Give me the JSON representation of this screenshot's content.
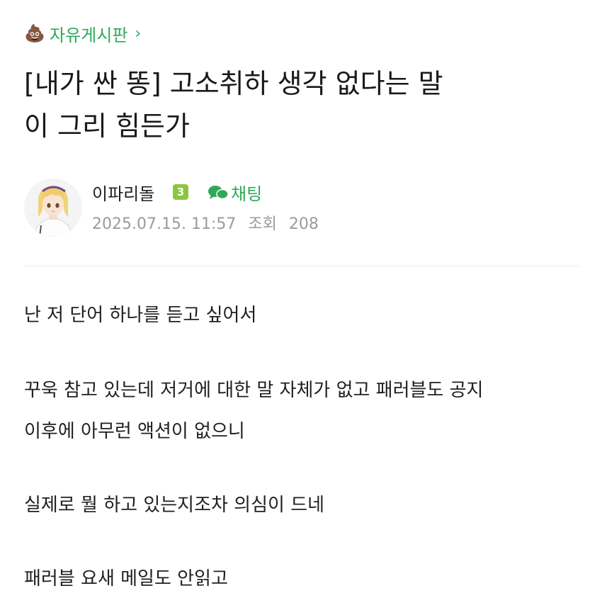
{
  "board": {
    "icon": "poop-emoji-icon",
    "icon_glyph": "💩",
    "name": "자유게시판",
    "chevron": "›"
  },
  "post": {
    "title_line1": "[내가 싼 똥] 고소취하 생각 없다는 말",
    "title_line2": "이 그리 힘든가"
  },
  "author": {
    "name": "이파리돌",
    "level": "3",
    "chat_label": "채팅",
    "date": "2025.07.15. 11:57",
    "views_label": "조회",
    "views": "208"
  },
  "body": {
    "line1": "난 저 단어 하나를 듣고 싶어서",
    "line2": "꾸욱 참고 있는데 저거에 대한 말 자체가 없고 패러블도 공지",
    "line3": "이후에 아무런 액션이 없으니",
    "line4": "실제로 뭘 하고 있는지조차 의심이 드네",
    "line5": "패러블 요새 메일도 안읽고"
  },
  "colors": {
    "accent": "#2fa85a",
    "level_badge": "#8cc63f",
    "meta_text": "#9b9b9b"
  }
}
